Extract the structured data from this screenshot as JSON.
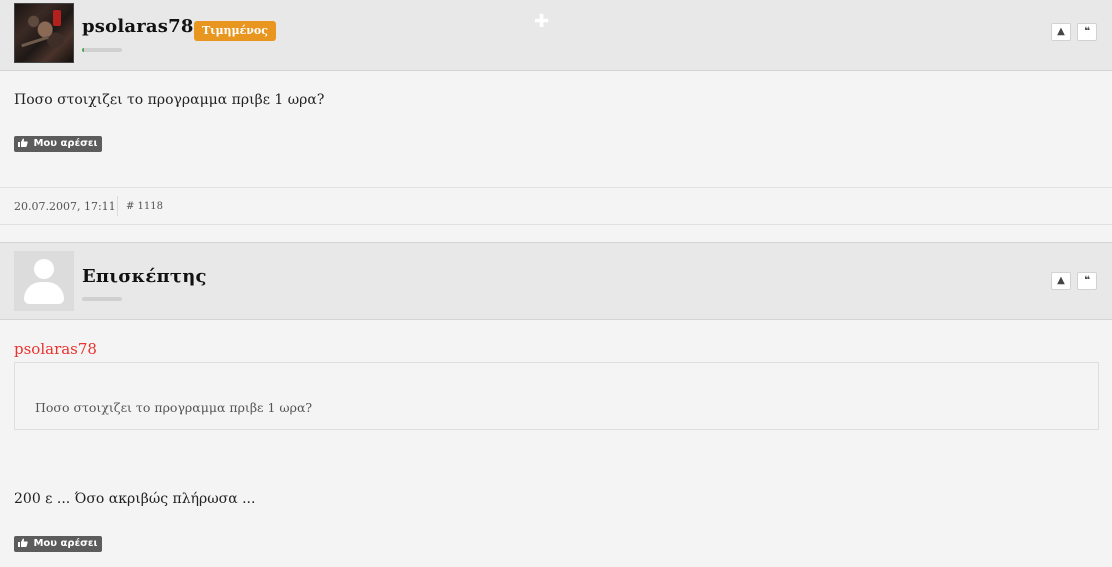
{
  "posts": [
    {
      "username": "psolaras78",
      "rank": "Τιμημένος",
      "reputation_fraction": 0.05,
      "body": "Ποσο στοιχιζει το προγραμμα πριβε 1 ωρα?",
      "like_label": "Μου αρέσει",
      "date": "20.07.2007, 17:11",
      "post_number": "# 1118",
      "controls": {
        "report": "▲",
        "quote": "❝"
      }
    },
    {
      "username": "Επισκέπτης",
      "reputation_fraction": 0,
      "quote": {
        "author": "psolaras78",
        "text": "Ποσο στοιχιζει το προγραμμα πριβε 1 ωρα?"
      },
      "body": "200 ε ... Όσο ακριβώς πλήρωσα ...",
      "like_label": "Μου αρέσει",
      "controls": {
        "report": "▲",
        "quote": "❝"
      }
    }
  ],
  "icons": {
    "plus": "✚",
    "like": "👍"
  },
  "colors": {
    "rank_badge": "#e8961f",
    "quote_author": "#e8332f",
    "like_button": "#5c5c5c",
    "reputation_fill": "#49a84b"
  }
}
